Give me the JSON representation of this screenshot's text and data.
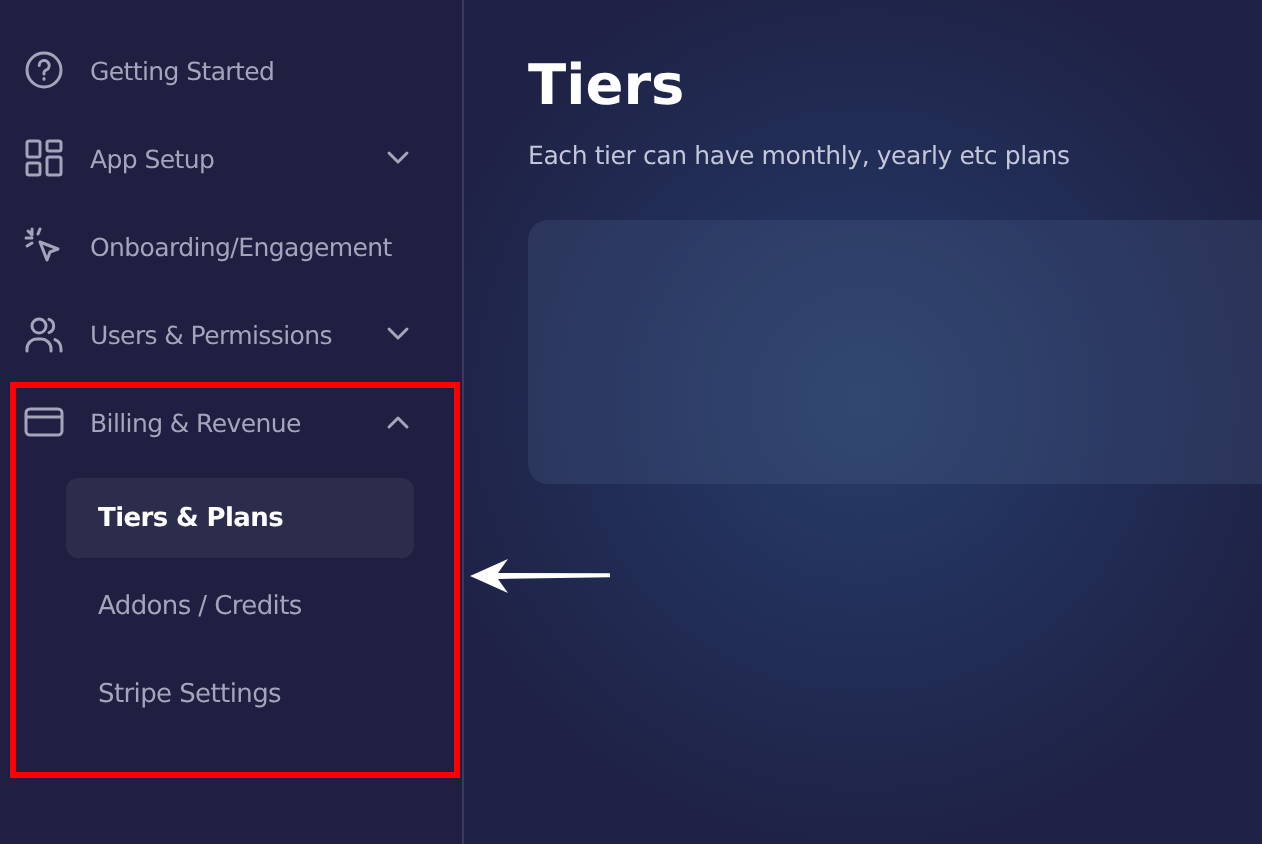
{
  "sidebar": {
    "items": [
      {
        "label": "Getting Started",
        "kind": "help",
        "expandable": false
      },
      {
        "label": "App Setup",
        "kind": "grid",
        "expandable": true,
        "expanded": false
      },
      {
        "label": "Onboarding/Engagement",
        "kind": "cursor",
        "expandable": false
      },
      {
        "label": "Users & Permissions",
        "kind": "users",
        "expandable": true,
        "expanded": false
      },
      {
        "label": "Billing & Revenue",
        "kind": "card",
        "expandable": true,
        "expanded": true,
        "children": [
          {
            "label": "Tiers & Plans",
            "selected": true
          },
          {
            "label": "Addons / Credits",
            "selected": false
          },
          {
            "label": "Stripe Settings",
            "selected": false
          }
        ]
      }
    ]
  },
  "main": {
    "title": "Tiers",
    "subtitle": "Each tier can have monthly, yearly etc plans"
  }
}
